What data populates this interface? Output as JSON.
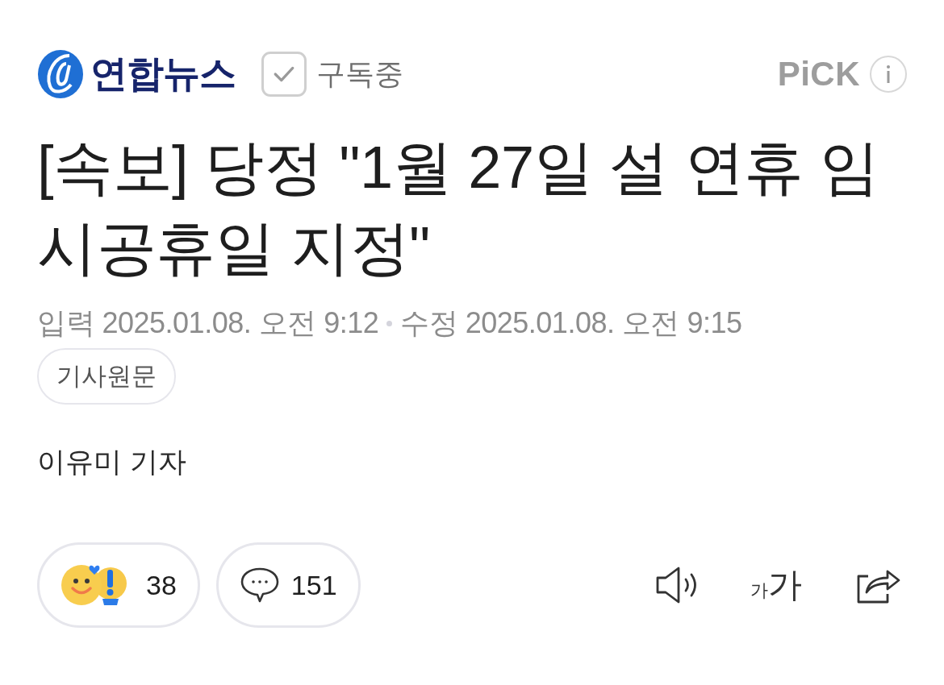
{
  "header": {
    "press_name": "연합뉴스",
    "subscription": {
      "label": "구독중",
      "subscribed": true
    },
    "pick_label": "PiCK"
  },
  "article": {
    "title": "[속보] 당정 \"1월 27일 설 연휴 임시공휴일 지정\"",
    "meta": [
      {
        "label": "입력",
        "value": "2025.01.08. 오전 9:12"
      },
      {
        "label": "수정",
        "value": "2025.01.08. 오전 9:15"
      }
    ],
    "original_link": "기사원문",
    "author": "이유미 기자"
  },
  "actions": {
    "reactions_count": "38",
    "comments_count": "151",
    "font_size_button": {
      "small": "가",
      "large": "가"
    }
  }
}
